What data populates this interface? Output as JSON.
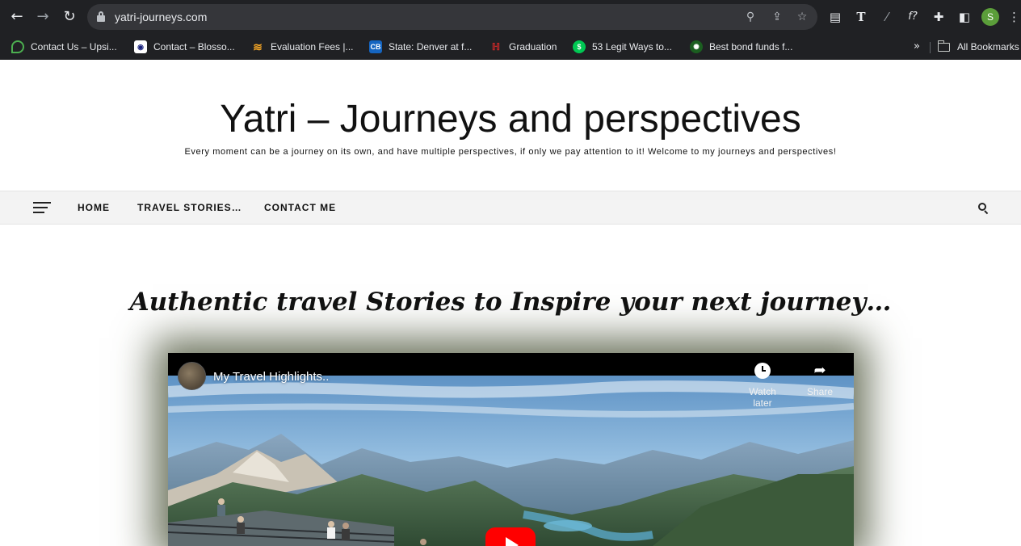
{
  "browser": {
    "url": "yatri-journeys.com",
    "profile_initial": "S",
    "bookmarks": [
      {
        "label": "Contact Us – Upsi...",
        "icon": "leaf-icon",
        "color": "#2e7d32"
      },
      {
        "label": "Contact – Blosso...",
        "icon": "blossom-icon",
        "color": "#1a237e"
      },
      {
        "label": "Evaluation Fees |...",
        "icon": "stack-icon",
        "color": "#f9a825"
      },
      {
        "label": "State: Denver at f...",
        "icon": "cb-icon",
        "color": "#1565c0"
      },
      {
        "label": "Graduation",
        "icon": "graduation-icon",
        "color": "#c62828"
      },
      {
        "label": "53 Legit Ways to...",
        "icon": "money-icon",
        "color": "#00c853"
      },
      {
        "label": "Best bond funds f...",
        "icon": "bond-icon",
        "color": "#1b5e20"
      }
    ],
    "all_bookmarks_label": "All Bookmarks"
  },
  "site": {
    "title": "Yatri – Journeys and perspectives",
    "tagline": "Every moment can be a journey on its own, and have multiple perspectives, if only we pay attention to it! Welcome to my journeys and perspectives!"
  },
  "menu": {
    "items": [
      "HOME",
      "TRAVEL STORIES…",
      "CONTACT ME"
    ]
  },
  "main": {
    "headline": "Authentic travel Stories to Inspire your next journey…"
  },
  "video": {
    "title": "My Travel Highlights..",
    "watch_later_label": "Watch later",
    "share_label": "Share"
  }
}
